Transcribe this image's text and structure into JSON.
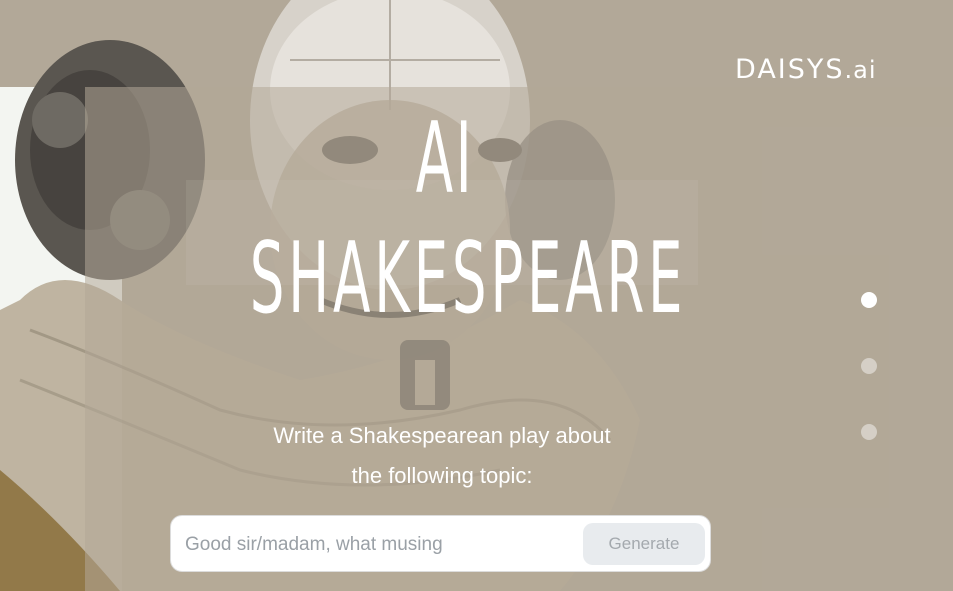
{
  "brand": {
    "name": "DAISYS",
    "suffix": ".ai"
  },
  "hero": {
    "title_line1": "AI",
    "title_line2": "SHAKESPEARE",
    "prompt_line1": "Write a Shakespearean play about",
    "prompt_line2": "the following topic:"
  },
  "search": {
    "placeholder": "Good sir/madam, what musing",
    "value": "",
    "button_label": "Generate"
  },
  "pagination": {
    "slides": 3,
    "active_index": 0
  },
  "colors": {
    "background": "#b2a898",
    "panel": "#f3f5f1",
    "button_bg": "#e8ebee",
    "button_text": "#a4a9ae"
  }
}
